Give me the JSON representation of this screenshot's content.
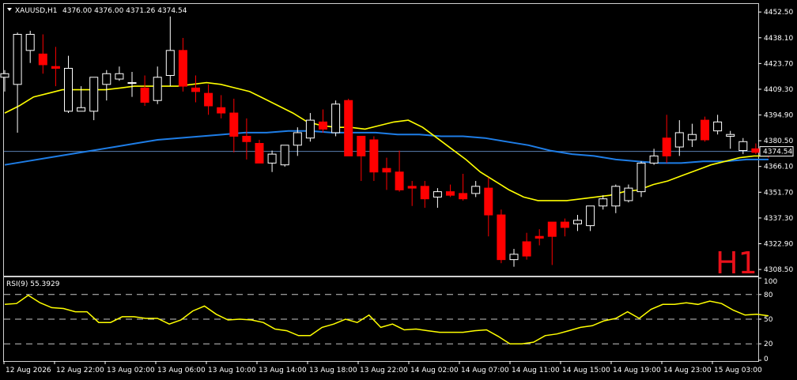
{
  "header": {
    "symbol": "XAUUSD,H1",
    "ohlc": "4376.00 4376.00 4371.26 4374.54",
    "timeframe_watermark": "H1"
  },
  "rsi_header": "RSI(9) 55.3929",
  "price_scale": [
    "4452.50",
    "4438.10",
    "4423.70",
    "4409.30",
    "4394.90",
    "4380.50",
    "4366.10",
    "4351.70",
    "4337.30",
    "4322.90",
    "4308.50"
  ],
  "current_price_label": "4374.54",
  "rsi_scale": [
    "100",
    "80",
    "50",
    "20",
    "0"
  ],
  "time_labels": [
    "12 Aug 2026",
    "12 Aug 22:00",
    "13 Aug 02:00",
    "13 Aug 06:00",
    "13 Aug 10:00",
    "13 Aug 14:00",
    "13 Aug 18:00",
    "13 Aug 22:00",
    "14 Aug 02:00",
    "14 Aug 07:00",
    "14 Aug 11:00",
    "14 Aug 15:00",
    "14 Aug 19:00",
    "14 Aug 23:00",
    "15 Aug 03:00"
  ],
  "colors": {
    "background": "#000000",
    "bull": "#ffffff",
    "bear": "#ff0000",
    "ma_fast": "#ffff00",
    "ma_slow": "#1e7de6",
    "rsi_line": "#ffff00",
    "grid_text": "#ffffff",
    "price_line": "#5a7fb0"
  },
  "chart_data": [
    {
      "type": "candlestick",
      "title": "XAUUSD,H1",
      "ylim": [
        4305,
        4457
      ],
      "bars": [
        {
          "o": 4416,
          "h": 4420,
          "l": 4408,
          "c": 4418
        },
        {
          "o": 4412,
          "h": 4441,
          "l": 4385,
          "c": 4440
        },
        {
          "o": 4431,
          "h": 4442,
          "l": 4424,
          "c": 4440
        },
        {
          "o": 4429,
          "h": 4440,
          "l": 4418,
          "c": 4423
        },
        {
          "o": 4422,
          "h": 4433,
          "l": 4411,
          "c": 4421
        },
        {
          "o": 4397,
          "h": 4428,
          "l": 4396,
          "c": 4421
        },
        {
          "o": 4397,
          "h": 4411,
          "l": 4397,
          "c": 4399
        },
        {
          "o": 4397,
          "h": 4412,
          "l": 4392,
          "c": 4416
        },
        {
          "o": 4412,
          "h": 4420,
          "l": 4403,
          "c": 4418
        },
        {
          "o": 4415,
          "h": 4422,
          "l": 4414,
          "c": 4418
        },
        {
          "o": 4413,
          "h": 4419,
          "l": 4405,
          "c": 4413
        },
        {
          "o": 4410,
          "h": 4417,
          "l": 4400,
          "c": 4402
        },
        {
          "o": 4403,
          "h": 4422,
          "l": 4401,
          "c": 4416
        },
        {
          "o": 4417,
          "h": 4450,
          "l": 4411,
          "c": 4431
        },
        {
          "o": 4431,
          "h": 4438,
          "l": 4408,
          "c": 4411
        },
        {
          "o": 4410,
          "h": 4417,
          "l": 4402,
          "c": 4408
        },
        {
          "o": 4407,
          "h": 4412,
          "l": 4395,
          "c": 4400
        },
        {
          "o": 4399,
          "h": 4406,
          "l": 4393,
          "c": 4396
        },
        {
          "o": 4396,
          "h": 4404,
          "l": 4374,
          "c": 4383
        },
        {
          "o": 4383,
          "h": 4393,
          "l": 4370,
          "c": 4380
        },
        {
          "o": 4379,
          "h": 4381,
          "l": 4368,
          "c": 4368
        },
        {
          "o": 4368,
          "h": 4375,
          "l": 4363,
          "c": 4373
        },
        {
          "o": 4367,
          "h": 4378,
          "l": 4366,
          "c": 4378
        },
        {
          "o": 4378,
          "h": 4388,
          "l": 4372,
          "c": 4385
        },
        {
          "o": 4382,
          "h": 4396,
          "l": 4380,
          "c": 4392
        },
        {
          "o": 4391,
          "h": 4398,
          "l": 4385,
          "c": 4387
        },
        {
          "o": 4385,
          "h": 4403,
          "l": 4383,
          "c": 4401
        },
        {
          "o": 4403,
          "h": 4404,
          "l": 4372,
          "c": 4372
        },
        {
          "o": 4383,
          "h": 4383,
          "l": 4358,
          "c": 4372
        },
        {
          "o": 4381,
          "h": 4383,
          "l": 4358,
          "c": 4363
        },
        {
          "o": 4365,
          "h": 4371,
          "l": 4353,
          "c": 4363
        },
        {
          "o": 4363,
          "h": 4375,
          "l": 4352,
          "c": 4353
        },
        {
          "o": 4355,
          "h": 4358,
          "l": 4344,
          "c": 4354
        },
        {
          "o": 4355,
          "h": 4358,
          "l": 4343,
          "c": 4348
        },
        {
          "o": 4349,
          "h": 4354,
          "l": 4343,
          "c": 4352
        },
        {
          "o": 4352,
          "h": 4356,
          "l": 4349,
          "c": 4350
        },
        {
          "o": 4351,
          "h": 4362,
          "l": 4347,
          "c": 4348
        },
        {
          "o": 4351,
          "h": 4358,
          "l": 4349,
          "c": 4355
        },
        {
          "o": 4354,
          "h": 4360,
          "l": 4327,
          "c": 4339
        },
        {
          "o": 4339,
          "h": 4342,
          "l": 4312,
          "c": 4314
        },
        {
          "o": 4314,
          "h": 4320,
          "l": 4310,
          "c": 4317
        },
        {
          "o": 4324,
          "h": 4329,
          "l": 4314,
          "c": 4316
        },
        {
          "o": 4327,
          "h": 4331,
          "l": 4322,
          "c": 4326
        },
        {
          "o": 4335,
          "h": 4331,
          "l": 4311,
          "c": 4327
        },
        {
          "o": 4335,
          "h": 4337,
          "l": 4327,
          "c": 4332
        },
        {
          "o": 4334,
          "h": 4339,
          "l": 4330,
          "c": 4336
        },
        {
          "o": 4333,
          "h": 4344,
          "l": 4330,
          "c": 4344
        },
        {
          "o": 4344,
          "h": 4350,
          "l": 4342,
          "c": 4348
        },
        {
          "o": 4344,
          "h": 4356,
          "l": 4340,
          "c": 4355
        },
        {
          "o": 4347,
          "h": 4356,
          "l": 4346,
          "c": 4354
        },
        {
          "o": 4352,
          "h": 4369,
          "l": 4349,
          "c": 4368
        },
        {
          "o": 4368,
          "h": 4376,
          "l": 4367,
          "c": 4372
        },
        {
          "o": 4382,
          "h": 4395,
          "l": 4368,
          "c": 4372
        },
        {
          "o": 4377,
          "h": 4392,
          "l": 4372,
          "c": 4385
        },
        {
          "o": 4381,
          "h": 4390,
          "l": 4377,
          "c": 4384
        },
        {
          "o": 4392,
          "h": 4394,
          "l": 4380,
          "c": 4381
        },
        {
          "o": 4386,
          "h": 4395,
          "l": 4384,
          "c": 4391
        },
        {
          "o": 4383,
          "h": 4386,
          "l": 4376,
          "c": 4384
        },
        {
          "o": 4375,
          "h": 4382,
          "l": 4373,
          "c": 4380
        },
        {
          "o": 4376,
          "h": 4379,
          "l": 4373,
          "c": 4374
        },
        {
          "o": 4376,
          "h": 4376,
          "l": 4371,
          "c": 4374.54
        }
      ],
      "ma_fast": [
        4396,
        4400,
        4405,
        4407,
        4409,
        4409,
        4409,
        4409,
        4410,
        4411,
        4411,
        4411,
        4411,
        4412,
        4413,
        4412,
        4410,
        4408,
        4404,
        4400,
        4396,
        4391,
        4389,
        4388,
        4388,
        4387,
        4389,
        4391,
        4392,
        4388,
        4382,
        4376,
        4370,
        4363,
        4358,
        4353,
        4349,
        4347,
        4347,
        4347,
        4348,
        4349,
        4350,
        4352,
        4353,
        4356,
        4358,
        4361,
        4364,
        4367,
        4369,
        4371,
        4372,
        4372
      ],
      "ma_slow": [
        4367,
        4369,
        4371,
        4373,
        4375,
        4377,
        4379,
        4381,
        4382,
        4383,
        4384,
        4385,
        4385,
        4386,
        4386,
        4385,
        4385,
        4385,
        4384,
        4384,
        4383,
        4383,
        4382,
        4380,
        4378,
        4375,
        4373,
        4372,
        4370,
        4369,
        4368,
        4368,
        4369,
        4369,
        4370,
        4370
      ],
      "current_price": 4374.54
    },
    {
      "type": "line",
      "title": "RSI(9) 55.3929",
      "ylim": [
        0,
        100
      ],
      "levels": [
        20,
        50,
        80
      ],
      "values": [
        68,
        69,
        79,
        70,
        64,
        63,
        59,
        59,
        46,
        46,
        53,
        53,
        51,
        51,
        44,
        49,
        60,
        66,
        56,
        49,
        50,
        49,
        46,
        38,
        36,
        30,
        30,
        40,
        44,
        50,
        46,
        55,
        40,
        44,
        37,
        38,
        36,
        34,
        34,
        34,
        36,
        37,
        29,
        20,
        20,
        22,
        30,
        32,
        36,
        40,
        42,
        48,
        51,
        59,
        51,
        62,
        68,
        68,
        70,
        68,
        72,
        69,
        61,
        55,
        56,
        54
      ]
    }
  ]
}
